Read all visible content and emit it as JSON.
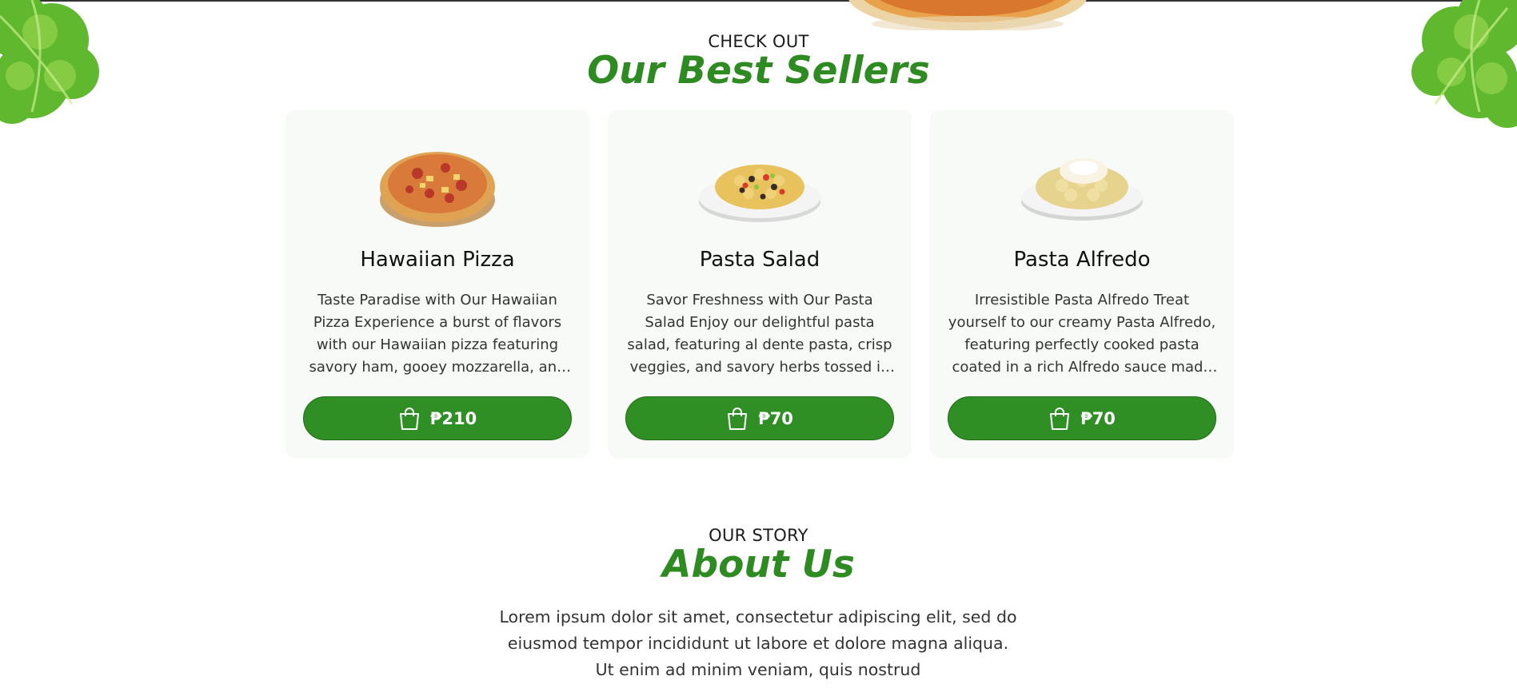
{
  "best_sellers": {
    "kicker": "CHECK OUT",
    "title": "Our Best Sellers",
    "items": [
      {
        "name": "Hawaiian Pizza",
        "description": "Taste Paradise with Our Hawaiian Pizza Experience a burst of flavors with our Hawaiian pizza featuring savory ham, gooey mozzarella, and sweet pineapple chunks.",
        "price": "₱210",
        "image": "pizza-image",
        "button_icon": "shopping-bag-icon"
      },
      {
        "name": "Pasta Salad",
        "description": "Savor Freshness with Our Pasta Salad Enjoy our delightful pasta salad, featuring al dente pasta, crisp veggies, and savory herbs tossed in a light dressing.",
        "price": "₱70",
        "image": "pasta-salad-image",
        "button_icon": "shopping-bag-icon"
      },
      {
        "name": "Pasta Alfredo",
        "description": "Irresistible Pasta Alfredo Treat yourself to our creamy Pasta Alfredo, featuring perfectly cooked pasta coated in a rich Alfredo sauce made with Parmesan cheese.",
        "price": "₱70",
        "image": "pasta-alfredo-image",
        "button_icon": "shopping-bag-icon"
      }
    ]
  },
  "about": {
    "kicker": "OUR STORY",
    "title": "About Us",
    "lines": [
      "Lorem ipsum dolor sit amet, consectetur adipiscing elit, sed do",
      "eiusmod tempor incididunt ut labore et dolore magna aliqua.",
      "Ut enim ad minim veniam, quis nostrud"
    ]
  },
  "colors": {
    "accent": "#2f8f24",
    "card_background": "#f7faf6"
  }
}
